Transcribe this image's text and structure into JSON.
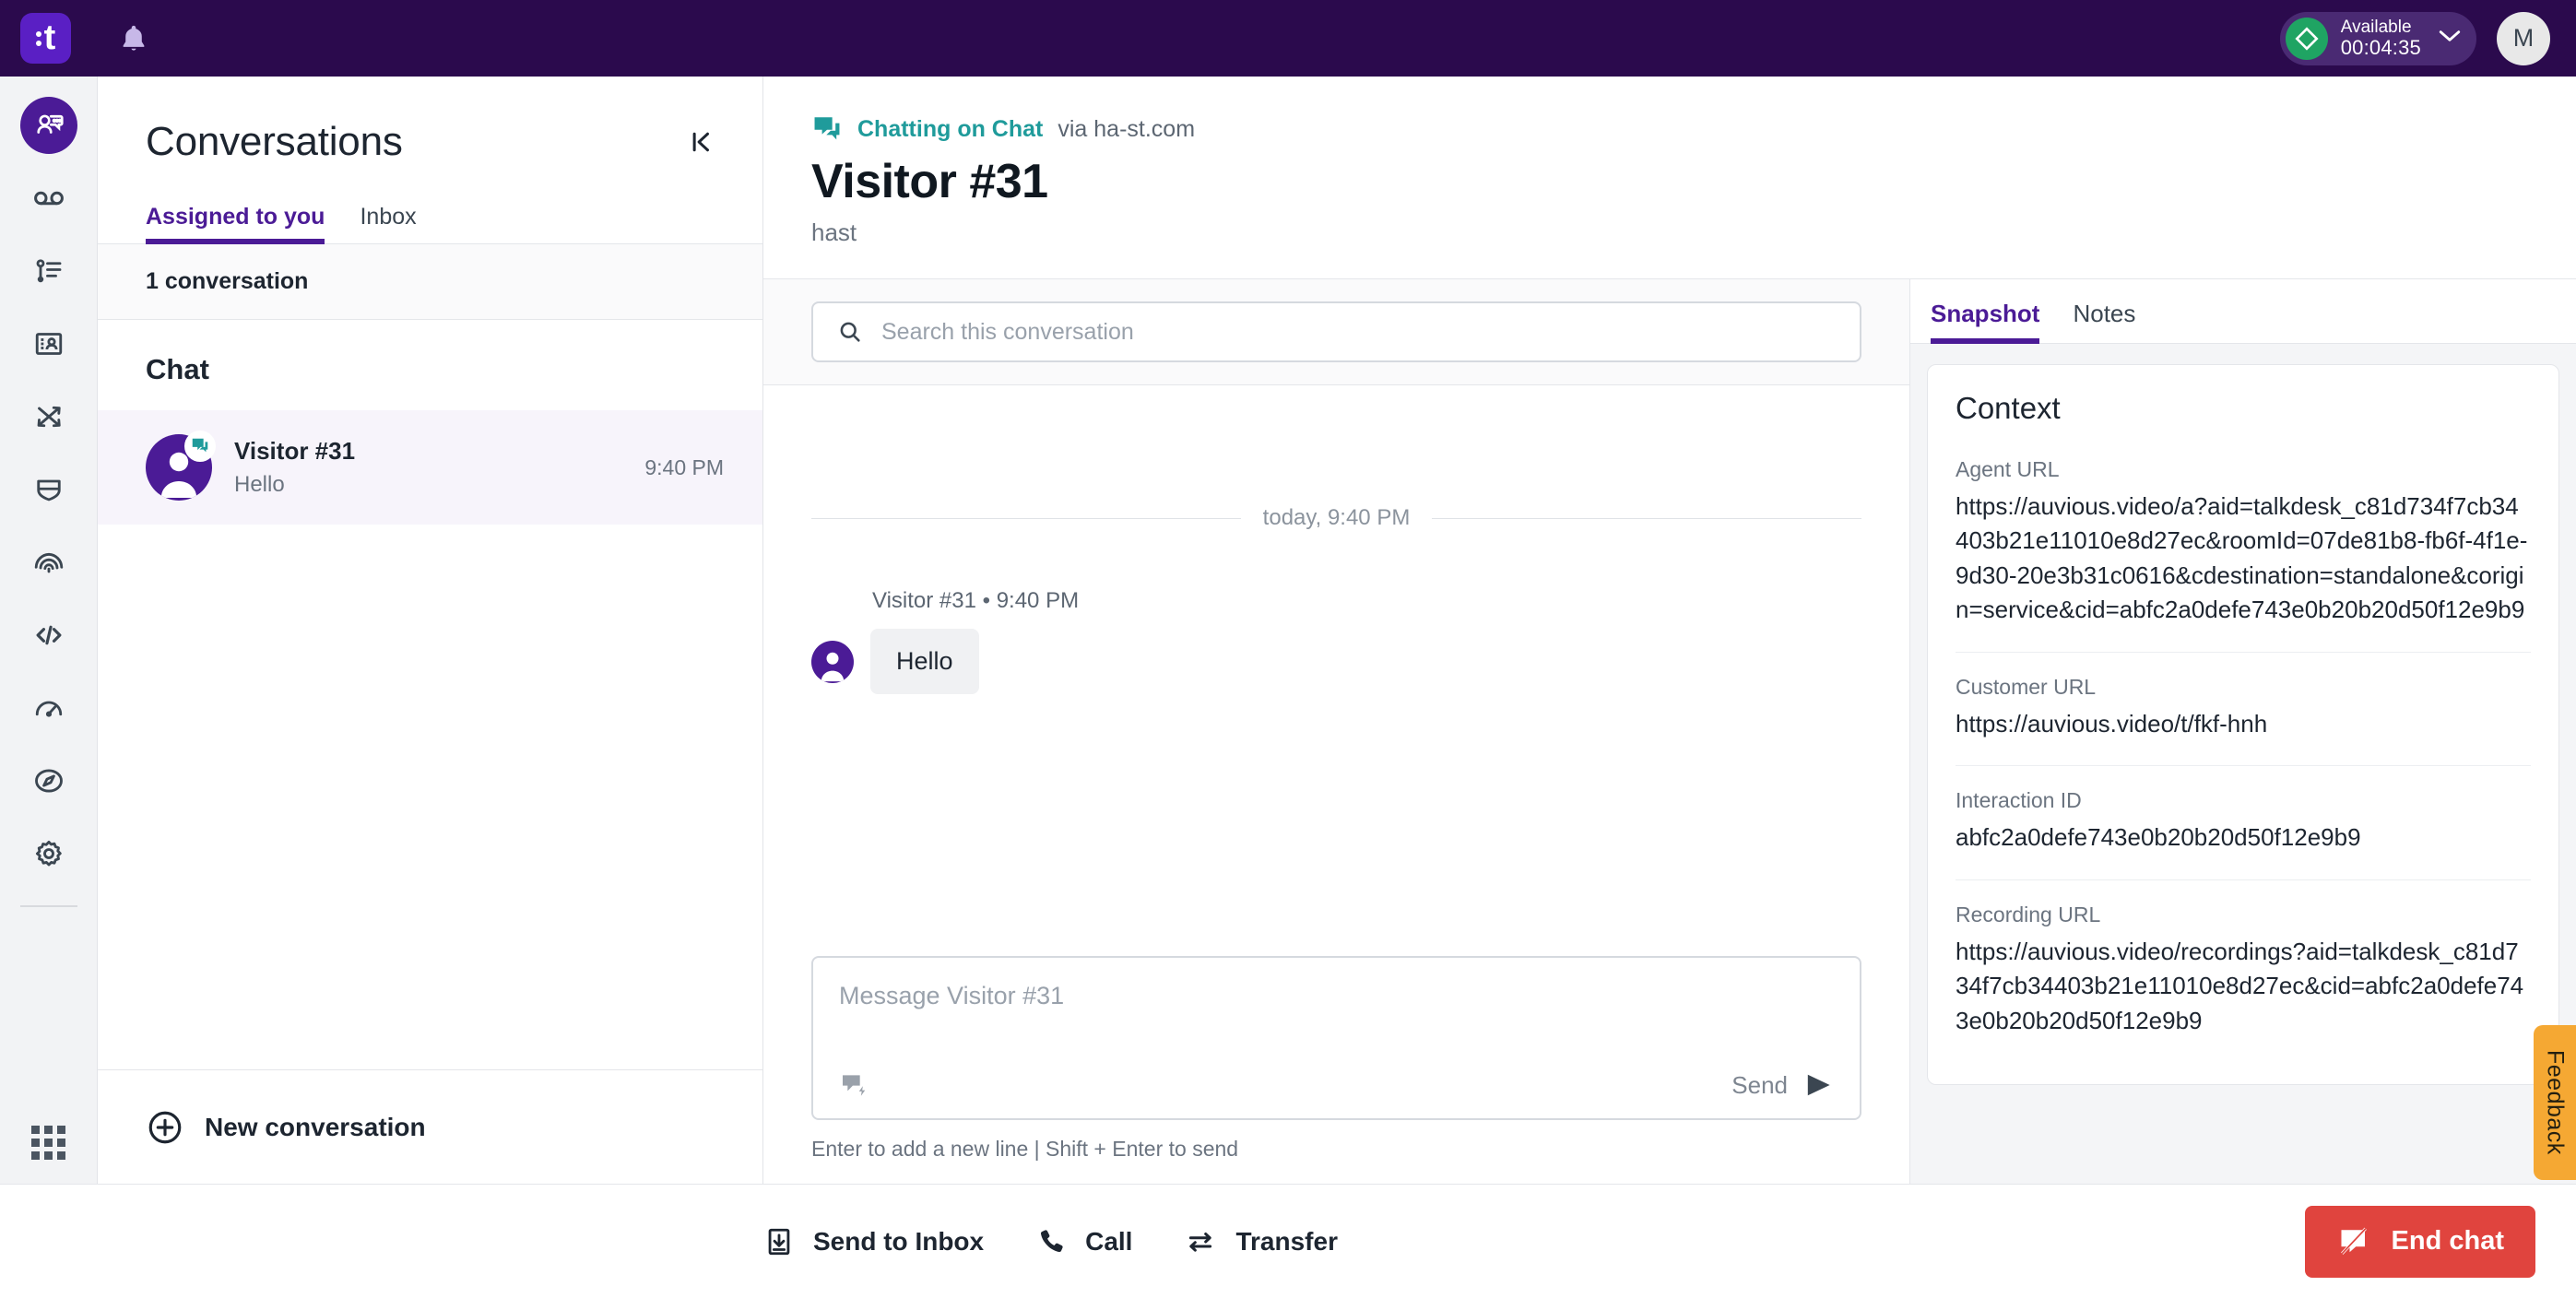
{
  "topbar": {
    "logo_letter": "t",
    "bell_icon": "bell-icon",
    "status": {
      "label": "Available",
      "timer": "00:04:35",
      "status_color": "#1fa463"
    },
    "avatar_initial": "M"
  },
  "rail": {
    "items": [
      {
        "name": "conversations",
        "icon": "chat-agent-icon",
        "active": true
      },
      {
        "name": "voicemail",
        "icon": "voicemail-icon",
        "active": false
      },
      {
        "name": "activity",
        "icon": "activity-list-icon",
        "active": false
      },
      {
        "name": "contacts",
        "icon": "contact-card-icon",
        "active": false
      },
      {
        "name": "routing",
        "icon": "routing-arrows-icon",
        "active": false
      },
      {
        "name": "guardian",
        "icon": "shield-icon",
        "active": false
      },
      {
        "name": "voice-id",
        "icon": "fingerprint-icon",
        "active": false
      },
      {
        "name": "developer",
        "icon": "code-icon",
        "active": false
      },
      {
        "name": "performance",
        "icon": "gauge-icon",
        "active": false
      },
      {
        "name": "explore",
        "icon": "compass-icon",
        "active": false
      },
      {
        "name": "settings",
        "icon": "gear-icon",
        "active": false
      }
    ],
    "apps_icon": "apps-grid-icon"
  },
  "conversations": {
    "title": "Conversations",
    "collapse_icon": "collapse-left-icon",
    "tabs": [
      {
        "label": "Assigned to you",
        "active": true
      },
      {
        "label": "Inbox",
        "active": false
      }
    ],
    "count_label": "1 conversation",
    "group_label": "Chat",
    "items": [
      {
        "name": "Visitor #31",
        "snippet": "Hello",
        "time": "9:40 PM",
        "badge_icon": "chat-badge-icon",
        "avatar_icon": "person-icon"
      }
    ],
    "new_conversation_label": "New conversation",
    "new_conversation_icon": "plus-circle-icon"
  },
  "chat": {
    "channel_icon": "chat-icon",
    "channel_label": "Chatting on Chat",
    "via_label": "via ha-st.com",
    "title": "Visitor #31",
    "subtitle": "hast",
    "search": {
      "placeholder": "Search this conversation",
      "value": "",
      "icon": "search-icon"
    },
    "day_separator": "today, 9:40 PM",
    "messages": [
      {
        "meta": "Visitor #31 • 9:40 PM",
        "text": "Hello",
        "avatar_icon": "person-icon"
      }
    ],
    "composer": {
      "placeholder": "Message Visitor #31",
      "value": "",
      "quick_reply_icon": "quick-reply-icon",
      "send_label": "Send",
      "send_icon": "send-arrow-icon",
      "hint": "Enter to add a new line | Shift + Enter to send"
    }
  },
  "right_panel": {
    "tabs": [
      {
        "label": "Snapshot",
        "active": true
      },
      {
        "label": "Notes",
        "active": false
      }
    ],
    "context": {
      "title": "Context",
      "fields": [
        {
          "label": "Agent URL",
          "value": "https://auvious.video/a?aid=talkdesk_c81d734f7cb34403b21e11010e8d27ec&roomId=07de81b8-fb6f-4f1e-9d30-20e3b31c0616&cdestination=standalone&corigin=service&cid=abfc2a0defe743e0b20b20d50f12e9b9"
        },
        {
          "label": "Customer URL",
          "value": "https://auvious.video/t/fkf-hnh"
        },
        {
          "label": "Interaction ID",
          "value": "abfc2a0defe743e0b20b20d50f12e9b9"
        },
        {
          "label": "Recording URL",
          "value": "https://auvious.video/recordings?aid=talkdesk_c81d734f7cb34403b21e11010e8d27ec&cid=abfc2a0defe743e0b20b20d50f12e9b9"
        }
      ]
    }
  },
  "feedback": {
    "label": "Feedback",
    "color": "#f5a833"
  },
  "bottombar": {
    "actions": [
      {
        "label": "Send to Inbox",
        "icon": "inbox-download-icon"
      },
      {
        "label": "Call",
        "icon": "phone-icon"
      },
      {
        "label": "Transfer",
        "icon": "transfer-arrows-icon"
      }
    ],
    "end_chat": {
      "label": "End chat",
      "icon": "chat-off-icon",
      "color": "#e0443e"
    }
  }
}
